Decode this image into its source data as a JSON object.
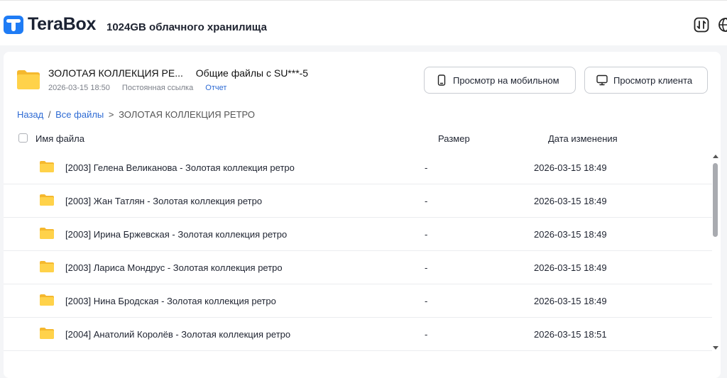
{
  "topbar": {
    "brand": "TeraBox",
    "storage": "1024GB облачного хранилища",
    "icons": [
      "transfer-icon",
      "globe-icon"
    ]
  },
  "share": {
    "folder_name": "ЗОЛОТАЯ КОЛЛЕКЦИЯ РЕ...",
    "shared_by": "Общие файлы с SU***-5",
    "date": "2026-03-15 18:50",
    "link_type": "Постоянная ссылка",
    "report": "Отчет",
    "mobile_button": "Просмотр на мобильном",
    "client_button": "Просмотр клиента"
  },
  "breadcrumb": {
    "back": "Назад",
    "all_files": "Все файлы",
    "separator": ">",
    "current": "ЗОЛОТАЯ КОЛЛЕКЦИЯ РЕТРО"
  },
  "table": {
    "columns": {
      "name": "Имя файла",
      "size": "Размер",
      "date": "Дата изменения"
    },
    "rows": [
      {
        "name": "[2003] Гелена Великанова - Золотая коллекция ретро",
        "size": "-",
        "date": "2026-03-15 18:49"
      },
      {
        "name": "[2003] Жан Татлян - Золотая коллекция ретро",
        "size": "-",
        "date": "2026-03-15 18:49"
      },
      {
        "name": "[2003] Ирина Бржевская - Золотая коллекция ретро",
        "size": "-",
        "date": "2026-03-15 18:49"
      },
      {
        "name": "[2003] Лариса Мондрус - Золотая коллекция ретро",
        "size": "-",
        "date": "2026-03-15 18:49"
      },
      {
        "name": "[2003] Нина Бродская - Золотая коллекция ретро",
        "size": "-",
        "date": "2026-03-15 18:49"
      },
      {
        "name": "[2004] Анатолий Королёв - Золотая коллекция ретро",
        "size": "-",
        "date": "2026-03-15 18:51"
      }
    ]
  },
  "colors": {
    "accent": "#2e6bd4",
    "logo": "#1f7cf5",
    "folder": "#ffc93c"
  }
}
